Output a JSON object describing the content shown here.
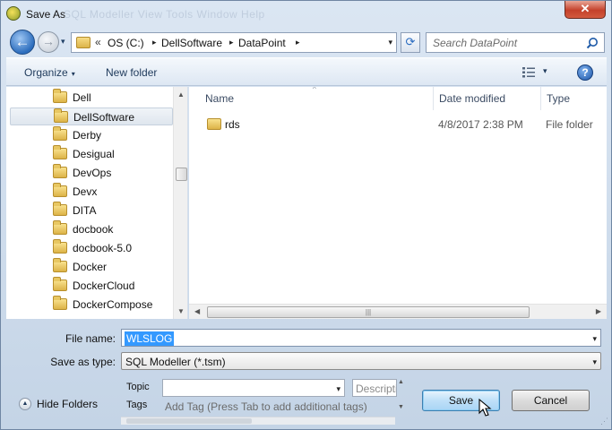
{
  "window": {
    "title": "Save As",
    "ghost_menu": "SQL Modeller   View   Tools   Window   Help",
    "close_glyph": "✕"
  },
  "nav": {
    "back_glyph": "←",
    "fwd_glyph": "→",
    "hist_glyph": "▾",
    "overflow": "«",
    "breadcrumbs": [
      "OS (C:)",
      "DellSoftware",
      "DataPoint"
    ],
    "crumb_arrow": "▸",
    "dropdown_glyph": "▾",
    "refresh_glyph": "⟳",
    "search_placeholder": "Search DataPoint"
  },
  "toolbar": {
    "organize_label": "Organize",
    "caret": "▾",
    "new_folder_label": "New folder",
    "help_glyph": "?"
  },
  "tree": {
    "items": [
      {
        "label": "Dell",
        "selected": false
      },
      {
        "label": "DellSoftware",
        "selected": true
      },
      {
        "label": "Derby",
        "selected": false
      },
      {
        "label": "Desigual",
        "selected": false
      },
      {
        "label": "DevOps",
        "selected": false
      },
      {
        "label": "Devx",
        "selected": false
      },
      {
        "label": "DITA",
        "selected": false
      },
      {
        "label": "docbook",
        "selected": false
      },
      {
        "label": "docbook-5.0",
        "selected": false
      },
      {
        "label": "Docker",
        "selected": false
      },
      {
        "label": "DockerCloud",
        "selected": false
      },
      {
        "label": "DockerCompose",
        "selected": false
      }
    ],
    "scroll_up": "▲",
    "scroll_down": "▼"
  },
  "files": {
    "columns": {
      "name": "Name",
      "date": "Date modified",
      "type": "Type"
    },
    "sort_glyph": "^",
    "rows": [
      {
        "name": "rds",
        "date": "4/8/2017 2:38 PM",
        "type": "File folder"
      }
    ],
    "scroll_left": "◀",
    "scroll_right": "▶",
    "thumb_grip": "|||"
  },
  "form": {
    "filename_label": "File name:",
    "filename_value": "WLSLOG",
    "savetype_label": "Save as type:",
    "savetype_value": "SQL Modeller (*.tsm)",
    "dropdown_glyph": "▾"
  },
  "meta": {
    "topic_label": "Topic",
    "tags_label": "Tags",
    "tags_placeholder": "Add Tag (Press Tab to add additional tags)",
    "description_placeholder": "Description",
    "scroll_up": "▲",
    "scroll_down": "▼"
  },
  "footer": {
    "hide_folders_label": "Hide Folders",
    "hide_glyph": "▲",
    "save_label": "Save",
    "cancel_label": "Cancel",
    "grip": "⋰"
  },
  "colors": {
    "accent": "#3399ff",
    "close": "#c4412b",
    "save_button": "#bfe0f8"
  }
}
